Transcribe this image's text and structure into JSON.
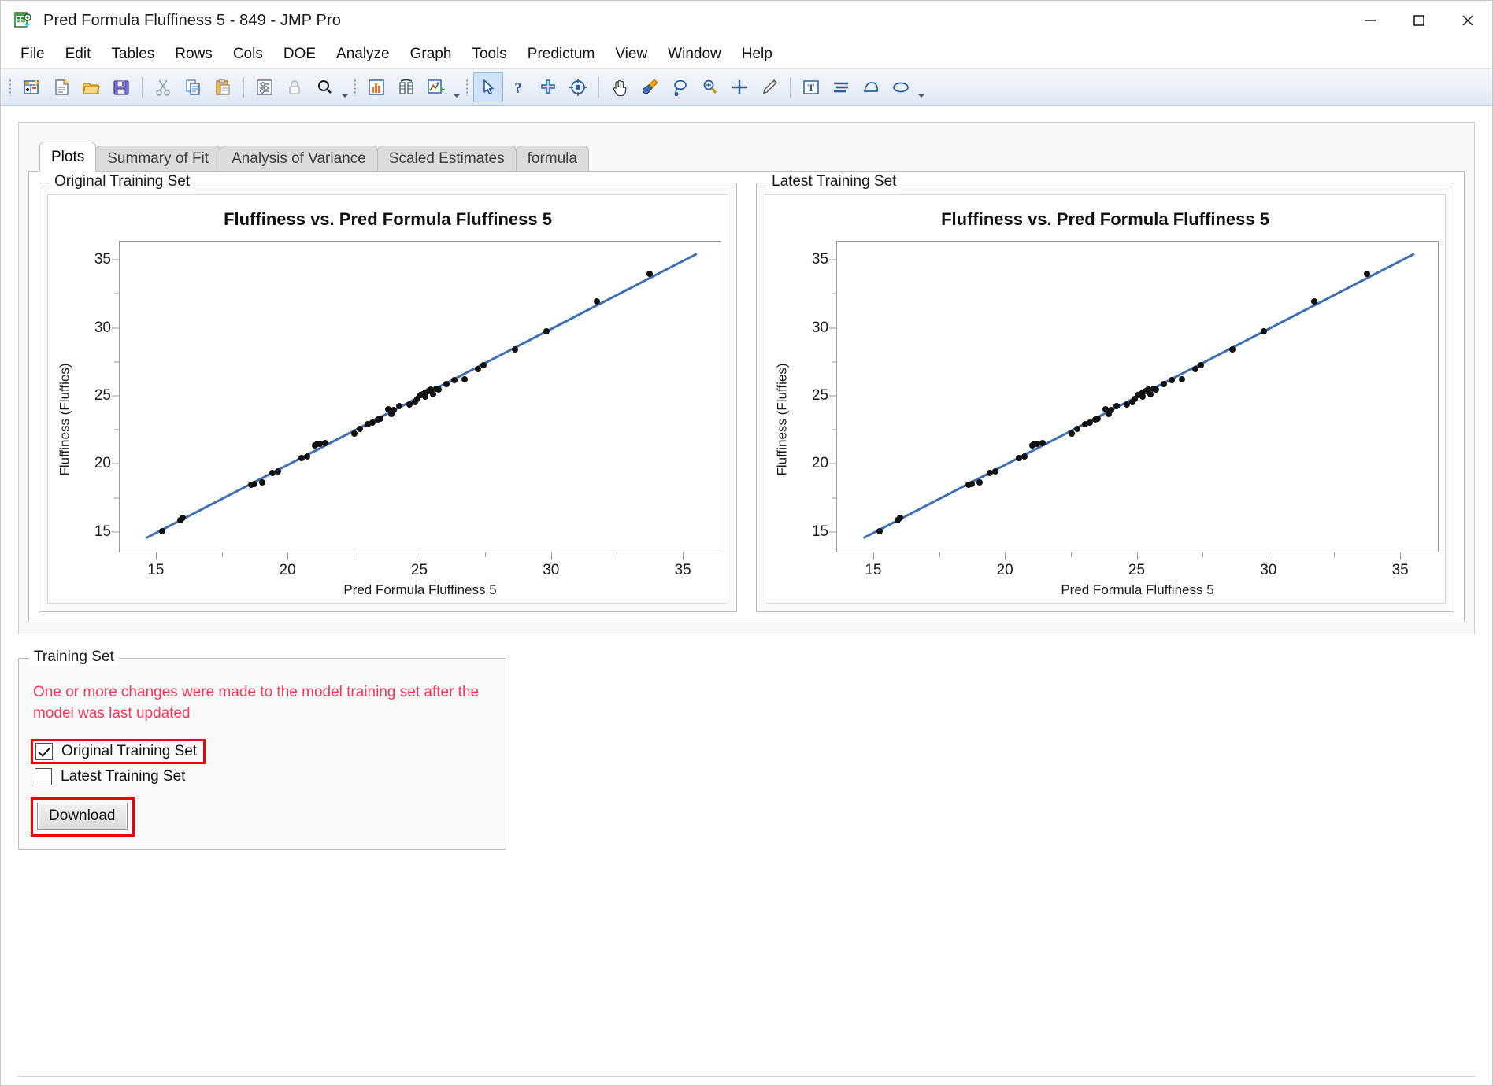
{
  "window": {
    "title": "Pred Formula Fluffiness 5 - 849 - JMP Pro",
    "icon": "jmp-data-table-icon",
    "minimize_label": "—",
    "maximize_label": "□",
    "close_label": "✕"
  },
  "menubar": {
    "items": [
      {
        "label": "File"
      },
      {
        "label": "Edit"
      },
      {
        "label": "Tables"
      },
      {
        "label": "Rows"
      },
      {
        "label": "Cols"
      },
      {
        "label": "DOE"
      },
      {
        "label": "Analyze"
      },
      {
        "label": "Graph"
      },
      {
        "label": "Tools"
      },
      {
        "label": "Predictum"
      },
      {
        "label": "View"
      },
      {
        "label": "Window"
      },
      {
        "label": "Help"
      }
    ]
  },
  "toolbar": {
    "groups": [
      {
        "icons": [
          "new-data-table-icon",
          "new-script-icon",
          "open-file-icon",
          "save-icon"
        ]
      },
      {
        "icons": [
          "cut-icon",
          "copy-icon",
          "paste-icon"
        ]
      },
      {
        "icons": [
          "data-filter-icon",
          "lock-icon",
          "search-icon"
        ]
      },
      {
        "icons": [
          "distribution-icon",
          "fit-y-by-x-icon",
          "graph-builder-icon"
        ]
      },
      {
        "icons": [
          "arrow-select-icon",
          "question-help-icon",
          "crosshair-brush-icon",
          "target-annotate-icon"
        ]
      },
      {
        "icons": [
          "hand-grabber-icon",
          "paint-brush-icon",
          "lasso-icon",
          "magnifier-zoom-icon",
          "crosshairs-icon",
          "pencil-icon"
        ]
      },
      {
        "icons": [
          "text-annotate-icon",
          "line-style-icon",
          "polygon-icon",
          "ellipse-icon"
        ]
      }
    ]
  },
  "tabs": {
    "items": [
      {
        "label": "Plots",
        "selected": true
      },
      {
        "label": "Summary of Fit",
        "selected": false
      },
      {
        "label": "Analysis of Variance",
        "selected": false
      },
      {
        "label": "Scaled Estimates",
        "selected": false
      },
      {
        "label": "formula",
        "selected": false
      }
    ]
  },
  "plots": {
    "left_group_title": "Original Training Set",
    "right_group_title": "Latest Training Set"
  },
  "training_set": {
    "group_title": "Training Set",
    "warning": "One or more changes were made to the model training set after the model was last updated",
    "warning_color": "#f2385a",
    "highlight_color": "#f00000",
    "checkboxes": [
      {
        "label": "Original Training Set",
        "checked": true,
        "highlighted": true
      },
      {
        "label": "Latest Training Set",
        "checked": false,
        "highlighted": false
      }
    ],
    "download_button": "Download"
  },
  "chart_data": [
    {
      "id": "original-training-set-plot",
      "type": "scatter",
      "title": "Fluffiness vs. Pred Formula Fluffiness 5",
      "xlabel": "Pred Formula Fluffiness 5",
      "ylabel": "Fluffiness (Fluffies)",
      "xlim": [
        13.6,
        36.4
      ],
      "ylim": [
        13.6,
        36.4
      ],
      "xticks": [
        15,
        20,
        25,
        30,
        35
      ],
      "yticks": [
        15,
        20,
        25,
        30,
        35
      ],
      "xminor": [
        17.5,
        22.5,
        27.5,
        32.5
      ],
      "yminor": [
        17.5,
        22.5,
        27.5,
        32.5
      ],
      "grid": false,
      "legend": "none",
      "fit_line": {
        "name": "Linear fit",
        "color": "#3f6fb0",
        "slope": 1.0,
        "intercept": 0.0,
        "x0": 14.6,
        "x1": 35.5
      },
      "point_color": "#111111",
      "points": [
        [
          15.2,
          15.1
        ],
        [
          15.9,
          15.9
        ],
        [
          16.0,
          16.1
        ],
        [
          18.6,
          18.5
        ],
        [
          18.7,
          18.6
        ],
        [
          19.0,
          18.7
        ],
        [
          19.4,
          19.4
        ],
        [
          19.6,
          19.5
        ],
        [
          20.5,
          20.5
        ],
        [
          20.7,
          20.6
        ],
        [
          21.0,
          21.4
        ],
        [
          21.1,
          21.5
        ],
        [
          21.2,
          21.5
        ],
        [
          21.4,
          21.6
        ],
        [
          22.5,
          22.3
        ],
        [
          22.7,
          22.6
        ],
        [
          23.0,
          23.0
        ],
        [
          23.2,
          23.1
        ],
        [
          23.4,
          23.3
        ],
        [
          23.5,
          23.4
        ],
        [
          23.8,
          24.1
        ],
        [
          23.9,
          23.7
        ],
        [
          24.0,
          24.0
        ],
        [
          24.2,
          24.3
        ],
        [
          24.6,
          24.4
        ],
        [
          24.8,
          24.6
        ],
        [
          24.9,
          24.8
        ],
        [
          25.0,
          25.1
        ],
        [
          25.1,
          25.2
        ],
        [
          25.2,
          25.3
        ],
        [
          25.2,
          25.0
        ],
        [
          25.3,
          25.4
        ],
        [
          25.4,
          25.5
        ],
        [
          25.5,
          25.2
        ],
        [
          25.6,
          25.6
        ],
        [
          25.7,
          25.5
        ],
        [
          26.0,
          25.9
        ],
        [
          26.3,
          26.2
        ],
        [
          26.7,
          26.3
        ],
        [
          27.2,
          27.0
        ],
        [
          27.4,
          27.3
        ],
        [
          28.6,
          28.5
        ],
        [
          29.8,
          29.8
        ],
        [
          31.7,
          32.0
        ],
        [
          33.7,
          34.0
        ]
      ]
    },
    {
      "id": "latest-training-set-plot",
      "type": "scatter",
      "title": "Fluffiness vs. Pred Formula Fluffiness 5",
      "xlabel": "Pred Formula Fluffiness 5",
      "ylabel": "Fluffiness (Fluffies)",
      "xlim": [
        13.6,
        36.4
      ],
      "ylim": [
        13.6,
        36.4
      ],
      "xticks": [
        15,
        20,
        25,
        30,
        35
      ],
      "yticks": [
        15,
        20,
        25,
        30,
        35
      ],
      "xminor": [
        17.5,
        22.5,
        27.5,
        32.5
      ],
      "yminor": [
        17.5,
        22.5,
        27.5,
        32.5
      ],
      "grid": false,
      "legend": "none",
      "fit_line": {
        "name": "Linear fit",
        "color": "#3f6fb0",
        "slope": 1.0,
        "intercept": 0.0,
        "x0": 14.6,
        "x1": 35.5
      },
      "point_color": "#111111",
      "points": [
        [
          15.2,
          15.1
        ],
        [
          15.9,
          15.9
        ],
        [
          16.0,
          16.1
        ],
        [
          18.6,
          18.5
        ],
        [
          18.7,
          18.6
        ],
        [
          19.0,
          18.7
        ],
        [
          19.4,
          19.4
        ],
        [
          19.6,
          19.5
        ],
        [
          20.5,
          20.5
        ],
        [
          20.7,
          20.6
        ],
        [
          21.0,
          21.4
        ],
        [
          21.1,
          21.5
        ],
        [
          21.2,
          21.5
        ],
        [
          21.4,
          21.6
        ],
        [
          22.5,
          22.3
        ],
        [
          22.7,
          22.6
        ],
        [
          23.0,
          23.0
        ],
        [
          23.2,
          23.1
        ],
        [
          23.4,
          23.3
        ],
        [
          23.5,
          23.4
        ],
        [
          23.8,
          24.1
        ],
        [
          23.9,
          23.7
        ],
        [
          24.0,
          24.0
        ],
        [
          24.2,
          24.3
        ],
        [
          24.6,
          24.4
        ],
        [
          24.8,
          24.6
        ],
        [
          24.9,
          24.8
        ],
        [
          25.0,
          25.1
        ],
        [
          25.1,
          25.2
        ],
        [
          25.2,
          25.3
        ],
        [
          25.2,
          25.0
        ],
        [
          25.3,
          25.4
        ],
        [
          25.4,
          25.5
        ],
        [
          25.5,
          25.2
        ],
        [
          25.6,
          25.6
        ],
        [
          25.7,
          25.5
        ],
        [
          26.0,
          25.9
        ],
        [
          26.3,
          26.2
        ],
        [
          26.7,
          26.3
        ],
        [
          27.2,
          27.0
        ],
        [
          27.4,
          27.3
        ],
        [
          28.6,
          28.5
        ],
        [
          29.8,
          29.8
        ],
        [
          31.7,
          32.0
        ],
        [
          33.7,
          34.0
        ]
      ]
    }
  ]
}
